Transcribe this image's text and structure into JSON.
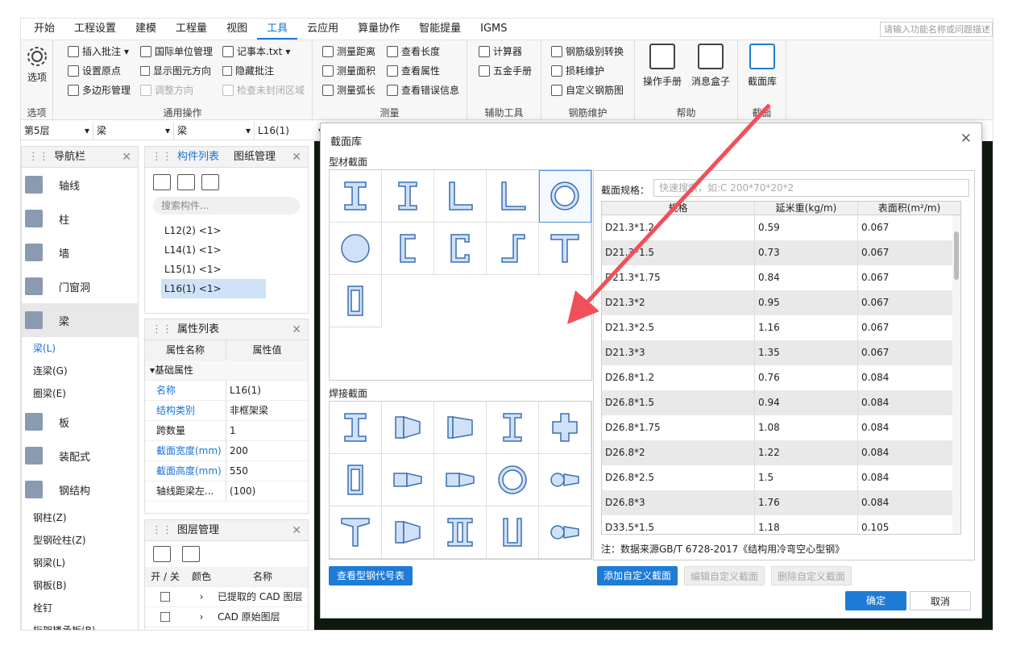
{
  "menu": [
    "开始",
    "工程设置",
    "建模",
    "工程量",
    "视图",
    "工具",
    "云应用",
    "算量协作",
    "智能提量",
    "IGMS"
  ],
  "menu_active_index": 5,
  "search_placeholder": "请输入功能名称或问题描述",
  "ribbon": {
    "options": {
      "button": "选项",
      "title": "选项"
    },
    "common": {
      "title": "通用操作",
      "items": [
        "插入批注",
        "国际单位管理",
        "记事本.txt",
        "设置原点",
        "显示图元方向",
        "隐藏批注",
        "多边形管理",
        "调整方向",
        "检查未封闭区域"
      ]
    },
    "measure": {
      "title": "测量",
      "items": [
        "测量距离",
        "查看长度",
        "测量面积",
        "查看属性",
        "测量弧长",
        "查看错误信息"
      ]
    },
    "aux": {
      "title": "辅助工具",
      "items": [
        "计算器",
        "五金手册"
      ]
    },
    "rebar": {
      "title": "钢筋维护",
      "items": [
        "钢筋级别转换",
        "损耗维护",
        "自定义钢筋图"
      ]
    },
    "help": {
      "title": "帮助",
      "items": [
        "操作手册",
        "消息盒子"
      ]
    },
    "section": {
      "title": "截面",
      "button": "截面库"
    }
  },
  "selectors": [
    "第5层",
    "梁",
    "梁",
    "L16(1)"
  ],
  "nav": {
    "title": "导航栏",
    "items": [
      "轴线",
      "柱",
      "墙",
      "门窗洞",
      "梁"
    ],
    "beam_subs": [
      "梁(L)",
      "连梁(G)",
      "圈梁(E)"
    ],
    "items2": [
      "板",
      "装配式",
      "钢结构"
    ],
    "steel_subs": [
      "钢柱(Z)",
      "型钢砼柱(Z)",
      "钢梁(L)",
      "钢板(B)",
      "栓钉",
      "桁架楼承板(B)"
    ]
  },
  "component": {
    "tabs": [
      "构件列表",
      "图纸管理"
    ],
    "search_placeholder": "搜索构件...",
    "items": [
      "L12(2) <1>",
      "L14(1) <1>",
      "L15(1) <1>",
      "L16(1) <1>"
    ]
  },
  "props": {
    "title": "属性列表",
    "headers": [
      "属性名称",
      "属性值"
    ],
    "group": "基础属性",
    "rows": [
      {
        "k": "名称",
        "v": "L16(1)",
        "blue": true
      },
      {
        "k": "结构类别",
        "v": "非框架梁",
        "blue": true
      },
      {
        "k": "跨数量",
        "v": "1",
        "blue": false
      },
      {
        "k": "截面宽度(mm)",
        "v": "200",
        "blue": true
      },
      {
        "k": "截面高度(mm)",
        "v": "550",
        "blue": true
      },
      {
        "k": "轴线距梁左...",
        "v": "(100)",
        "blue": false
      }
    ]
  },
  "layers": {
    "title": "图层管理",
    "headers": [
      "开 / 关",
      "颜色",
      "名称"
    ],
    "rows": [
      "已提取的 CAD 图层",
      "CAD 原始图层"
    ]
  },
  "dialog": {
    "title": "截面库",
    "profile_label": "型材截面",
    "weld_label": "焊接截面",
    "spec_label": "截面规格：",
    "spec_placeholder": "快速搜索，如:C 200*70*20*2",
    "table_headers": [
      "规格",
      "延米重(kg/m)",
      "表面积(m²/m)"
    ],
    "rows": [
      [
        "D21.3*1.2",
        "0.59",
        "0.067"
      ],
      [
        "D21.3*1.5",
        "0.73",
        "0.067"
      ],
      [
        "D21.3*1.75",
        "0.84",
        "0.067"
      ],
      [
        "D21.3*2",
        "0.95",
        "0.067"
      ],
      [
        "D21.3*2.5",
        "1.16",
        "0.067"
      ],
      [
        "D21.3*3",
        "1.35",
        "0.067"
      ],
      [
        "D26.8*1.2",
        "0.76",
        "0.084"
      ],
      [
        "D26.8*1.5",
        "0.94",
        "0.084"
      ],
      [
        "D26.8*1.75",
        "1.08",
        "0.084"
      ],
      [
        "D26.8*2",
        "1.22",
        "0.084"
      ],
      [
        "D26.8*2.5",
        "1.5",
        "0.084"
      ],
      [
        "D26.8*3",
        "1.76",
        "0.084"
      ],
      [
        "D33.5*1.5",
        "1.18",
        "0.105"
      ]
    ],
    "note": "注：数据来源GB/T 6728-2017《结构用冷弯空心型钢》",
    "btn_view_codes": "查看型钢代号表",
    "btn_add": "添加自定义截面",
    "btn_edit": "编辑自定义截面",
    "btn_delete": "删除自定义截面",
    "btn_ok": "确定",
    "btn_cancel": "取消"
  },
  "accent_color": "#1e7bd6",
  "arrow_color": "#f0505a"
}
